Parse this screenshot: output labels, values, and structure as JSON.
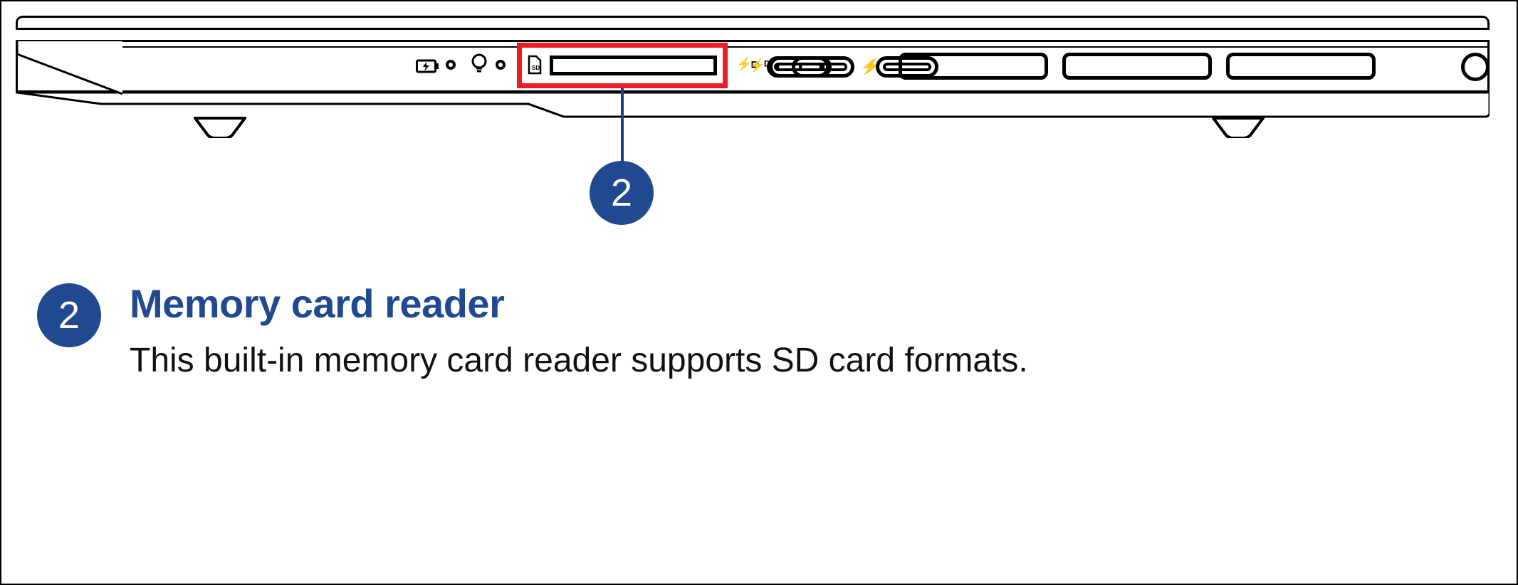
{
  "callout": {
    "diagram_number": "2",
    "text_number": "2",
    "title": "Memory card reader",
    "body": "This built-in memory card reader supports SD card formats."
  },
  "icons": {
    "sd_label_text": "SD"
  },
  "colors": {
    "accent": "#204990",
    "highlight": "#ed1c24"
  }
}
